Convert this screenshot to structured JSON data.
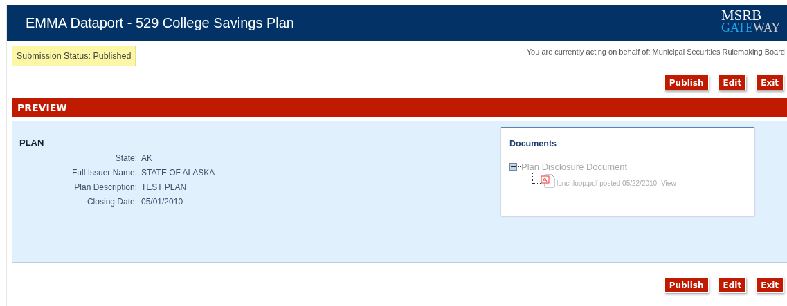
{
  "header": {
    "title": "EMMA Dataport - 529 College Savings Plan",
    "logo_top": "MSRB",
    "logo_bottom_highlight": "GATE",
    "logo_bottom_rest": "WAY"
  },
  "status": "Submission Status: Published",
  "acting_on_behalf": "You are currently acting on behalf of: Municipal Securities Rulemaking Board",
  "top_buttons": [
    "Publish",
    "Edit",
    "Exit"
  ],
  "section_title": "PREVIEW",
  "plan": {
    "heading": "PLAN",
    "fields": [
      {
        "label": "State:",
        "value": "AK"
      },
      {
        "label": "Full Issuer Name:",
        "value": "STATE OF ALASKA"
      },
      {
        "label": "Plan Description:",
        "value": "TEST PLAN"
      },
      {
        "label": "Closing Date:",
        "value": "05/01/2010"
      }
    ]
  },
  "documents": {
    "title": "Documents",
    "tree": [
      {
        "label": "Plan Disclosure Document",
        "expanded": true,
        "children": [
          {
            "file": "lunchloop.pdf posted 05/22/2010",
            "link": "View"
          }
        ]
      }
    ]
  },
  "bottom_buttons": [
    "Publish",
    "Edit",
    "Exit"
  ]
}
